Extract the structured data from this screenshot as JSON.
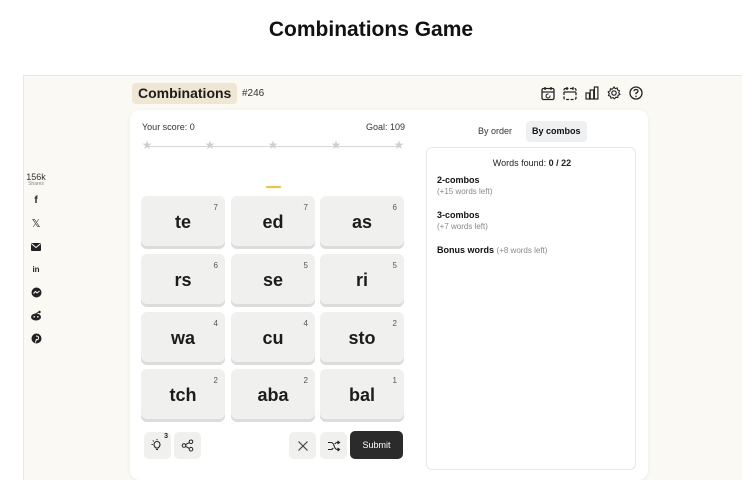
{
  "page": {
    "title": "Combinations Game"
  },
  "share": {
    "count": "156k",
    "count_label": "Shares",
    "icons": [
      "facebook-icon",
      "x-icon",
      "email-icon",
      "linkedin-icon",
      "messenger-icon",
      "reddit-icon",
      "pinterest-icon"
    ],
    "glyphs": {
      "facebook": "f",
      "x": "𝕏",
      "linkedin": "in"
    }
  },
  "header": {
    "brand": "Combinations",
    "game_number": "#246",
    "icons": [
      "calendar-refresh-icon",
      "calendar-archive-icon",
      "stats-icon",
      "settings-icon",
      "help-icon"
    ]
  },
  "score": {
    "label": "Your score: 0",
    "goal": "Goal: 109",
    "stars_total": 5,
    "stars_filled": 0
  },
  "tiles": [
    {
      "text": "te",
      "count": "7"
    },
    {
      "text": "ed",
      "count": "7"
    },
    {
      "text": "as",
      "count": "6"
    },
    {
      "text": "rs",
      "count": "6"
    },
    {
      "text": "se",
      "count": "5"
    },
    {
      "text": "ri",
      "count": "5"
    },
    {
      "text": "wa",
      "count": "4"
    },
    {
      "text": "cu",
      "count": "4"
    },
    {
      "text": "sto",
      "count": "2"
    },
    {
      "text": "tch",
      "count": "2"
    },
    {
      "text": "aba",
      "count": "2"
    },
    {
      "text": "bal",
      "count": "1"
    }
  ],
  "controls": {
    "hint_count": "3",
    "submit_label": "Submit",
    "icons": [
      "hint-bulb-icon",
      "share-icon",
      "clear-icon",
      "shuffle-icon"
    ]
  },
  "view_toggle": {
    "by_order": "By order",
    "by_combos": "By combos",
    "active": "by_combos"
  },
  "words": {
    "found_label": "Words found: ",
    "found_value": "0 / 22",
    "categories": [
      {
        "name": "2-combos",
        "left": "(+15 words left)"
      },
      {
        "name": "3-combos",
        "left": "(+7 words left)"
      },
      {
        "name": "Bonus words",
        "left": "(+8 words left)"
      }
    ]
  },
  "colors": {
    "accent": "#f1c232",
    "brand_bg": "#efe6d3",
    "submit_bg": "#2b2b2b",
    "tile_bg": "#f0f0ef"
  }
}
